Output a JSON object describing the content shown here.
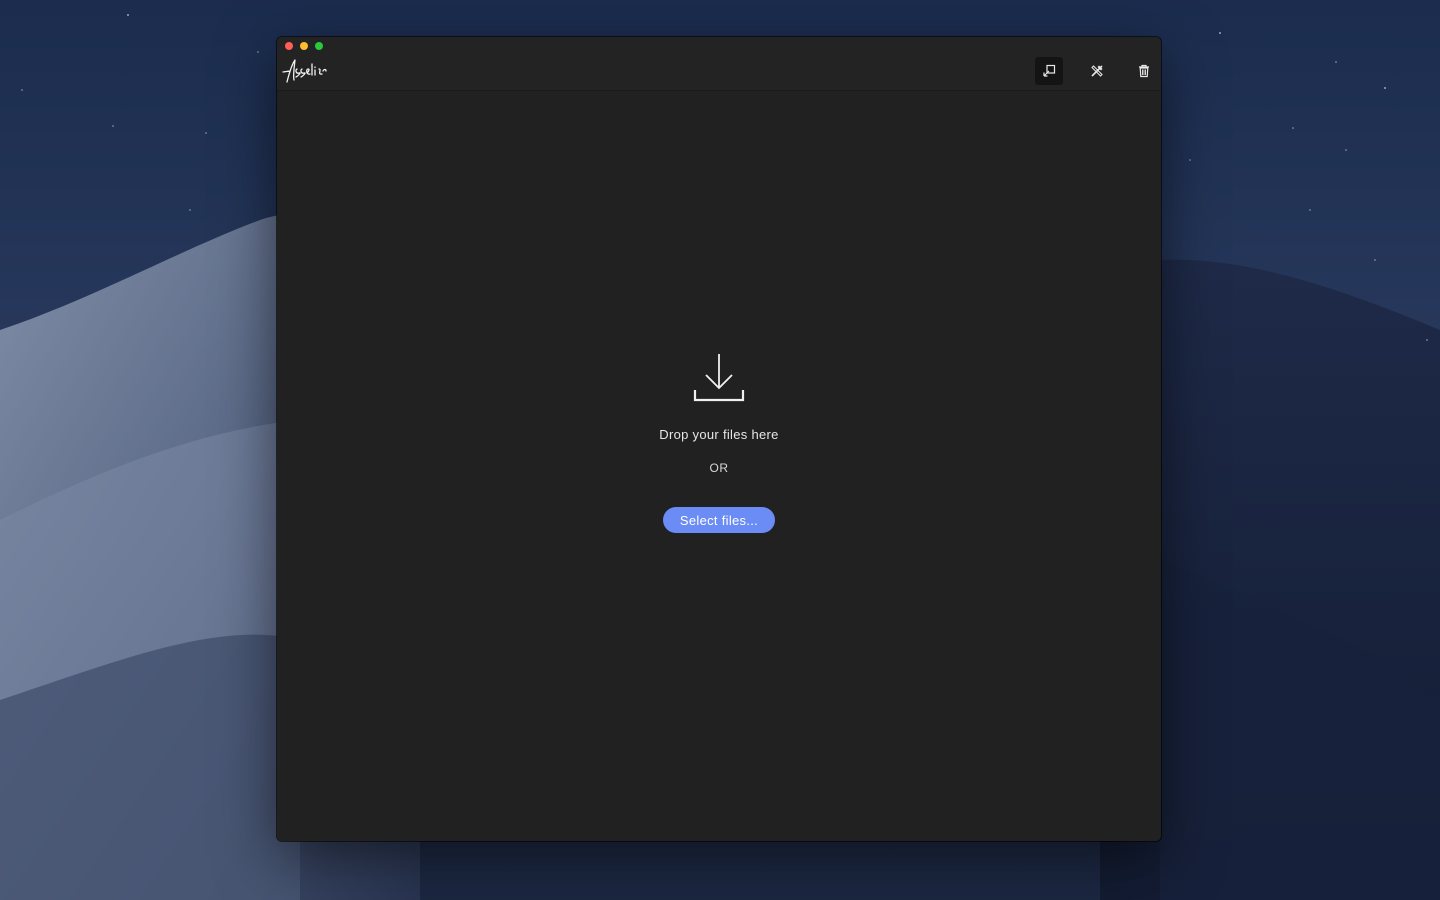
{
  "window": {
    "app_name": "Assetizer",
    "traffic_lights": [
      "close",
      "minimize",
      "maximize"
    ]
  },
  "toolbar": {
    "buttons": [
      {
        "icon": "export-icon",
        "active": true
      },
      {
        "icon": "tools-icon",
        "active": false
      },
      {
        "icon": "trash-icon",
        "active": false
      }
    ]
  },
  "dropzone": {
    "icon": "download-tray-icon",
    "message": "Drop your files here",
    "separator": "OR",
    "select_button_label": "Select files..."
  },
  "colors": {
    "window_bg": "#212121",
    "titlebar_bg": "#232323",
    "accent": "#6b8cf5",
    "text": "#e6e6e6"
  }
}
